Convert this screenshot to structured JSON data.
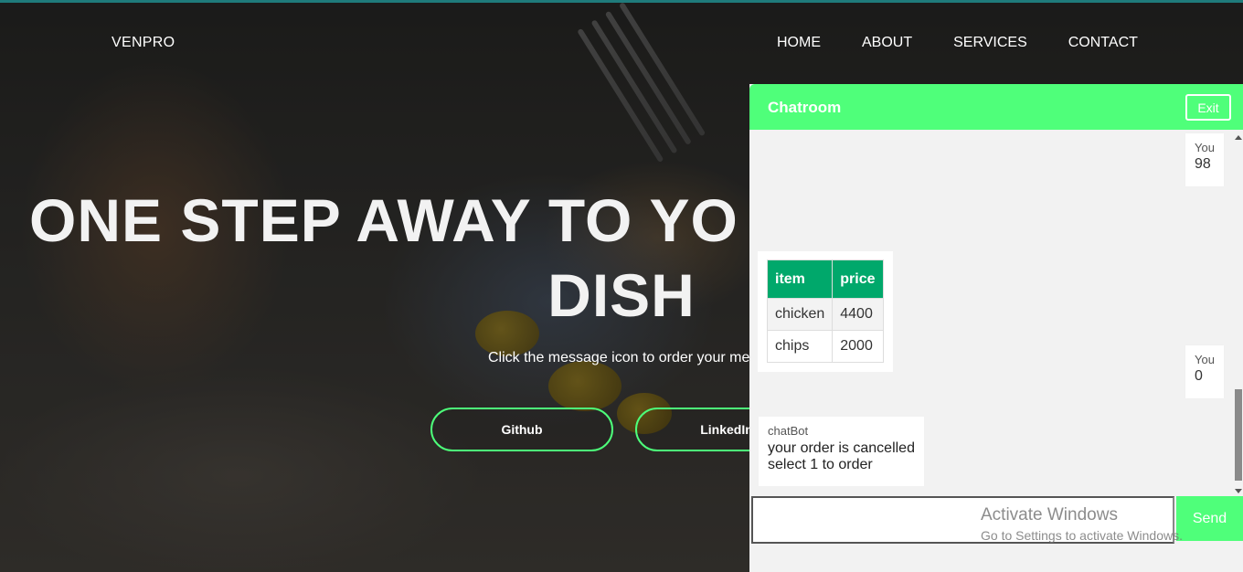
{
  "navbar": {
    "brand": "VENPRO",
    "links": [
      "HOME",
      "ABOUT",
      "SERVICES",
      "CONTACT"
    ]
  },
  "hero": {
    "title_line1": "ONE STEP AWAY TO YO",
    "title_line2": "DISH",
    "subtitle": "Click the message icon to order your me",
    "buttons": [
      "Github",
      "LinkedIn"
    ]
  },
  "chat": {
    "title": "Chatroom",
    "exit_label": "Exit",
    "messages": {
      "you1": {
        "sender": "You",
        "text": "98"
      },
      "you2": {
        "sender": "You",
        "text": "0"
      },
      "bot": {
        "sender": "chatBot",
        "line1": "your order is cancelled",
        "line2": "select 1 to order"
      }
    },
    "menu_table": {
      "headers": [
        "item",
        "price"
      ],
      "rows": [
        [
          "chicken",
          "4400"
        ],
        [
          "chips",
          "2000"
        ]
      ]
    },
    "send_label": "Send"
  },
  "watermark": {
    "line1": "Activate Windows",
    "line2": "Go to Settings to activate Windows."
  },
  "colors": {
    "accent_green": "#4fff7a",
    "table_header": "#00a86b",
    "chat_bg": "#f2f2f2"
  }
}
